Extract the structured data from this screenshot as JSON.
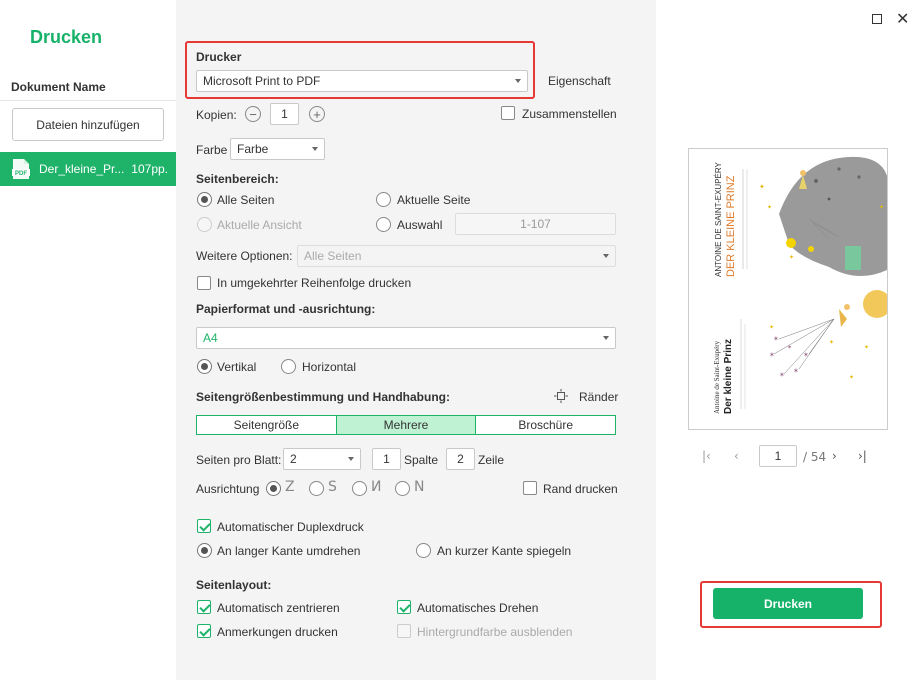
{
  "app": {
    "title": "Drucken"
  },
  "sidebar": {
    "header": "Dokument Name",
    "add_files": "Dateien hinzufügen",
    "files": [
      {
        "name": "Der_kleine_Pr...",
        "pages": "107pp.",
        "icon_label": "PDF"
      }
    ]
  },
  "printer": {
    "section": "Drucker",
    "selected": "Microsoft Print to PDF",
    "properties": "Eigenschaft"
  },
  "copies": {
    "label": "Kopien:",
    "value": "1",
    "minus": "−",
    "plus": "+",
    "collate": "Zusammenstellen"
  },
  "color": {
    "label": "Farbe",
    "selected": "Farbe"
  },
  "page_range": {
    "section": "Seitenbereich:",
    "all": "Alle Seiten",
    "current": "Aktuelle Seite",
    "current_view": "Aktuelle Ansicht",
    "selection": "Auswahl",
    "range_value": "1-107"
  },
  "more_options": {
    "label": "Weitere Optionen:",
    "selected": "Alle Seiten",
    "reverse": "In umgekehrter Reihenfolge drucken"
  },
  "paper": {
    "section": "Papierformat und -ausrichtung:",
    "selected": "A4",
    "portrait": "Vertikal",
    "landscape": "Horizontal"
  },
  "sizing": {
    "section": "Seitengrößenbestimmung und Handhabung:",
    "margins": "Ränder",
    "tabs": [
      "Seitengröße",
      "Mehrere",
      "Broschüre"
    ],
    "pages_per_sheet_label": "Seiten pro Blatt:",
    "pages_per_sheet": "2",
    "columns_value": "1",
    "columns_label": "Spalte",
    "rows_value": "2",
    "rows_label": "Zeile",
    "orientation_label": "Ausrichtung",
    "orient_glyphs": [
      "Z",
      "S",
      "И",
      "N"
    ],
    "border": "Rand drucken"
  },
  "duplex": {
    "auto": "Automatischer Duplexdruck",
    "long": "An langer Kante umdrehen",
    "short": "An kurzer Kante spiegeln"
  },
  "layout": {
    "section": "Seitenlayout:",
    "center": "Automatisch zentrieren",
    "rotate": "Automatisches Drehen",
    "annotations": "Anmerkungen drucken",
    "hide_bg": "Hintergrundfarbe ausblenden"
  },
  "preview": {
    "current_page": "1",
    "total": "/ 54",
    "book_top": {
      "author": "ANTOINE DE SAINT-EXUPÉRY",
      "title": "DER KLEINE PRINZ"
    },
    "book_bottom": {
      "author": "Antoine de Saint-Exupéry",
      "title": "Der kleine Prinz"
    }
  },
  "actions": {
    "print": "Drucken"
  },
  "colors": {
    "accent": "#17b26a",
    "highlight": "#e53935",
    "panel_bg": "#f4f4f4"
  }
}
